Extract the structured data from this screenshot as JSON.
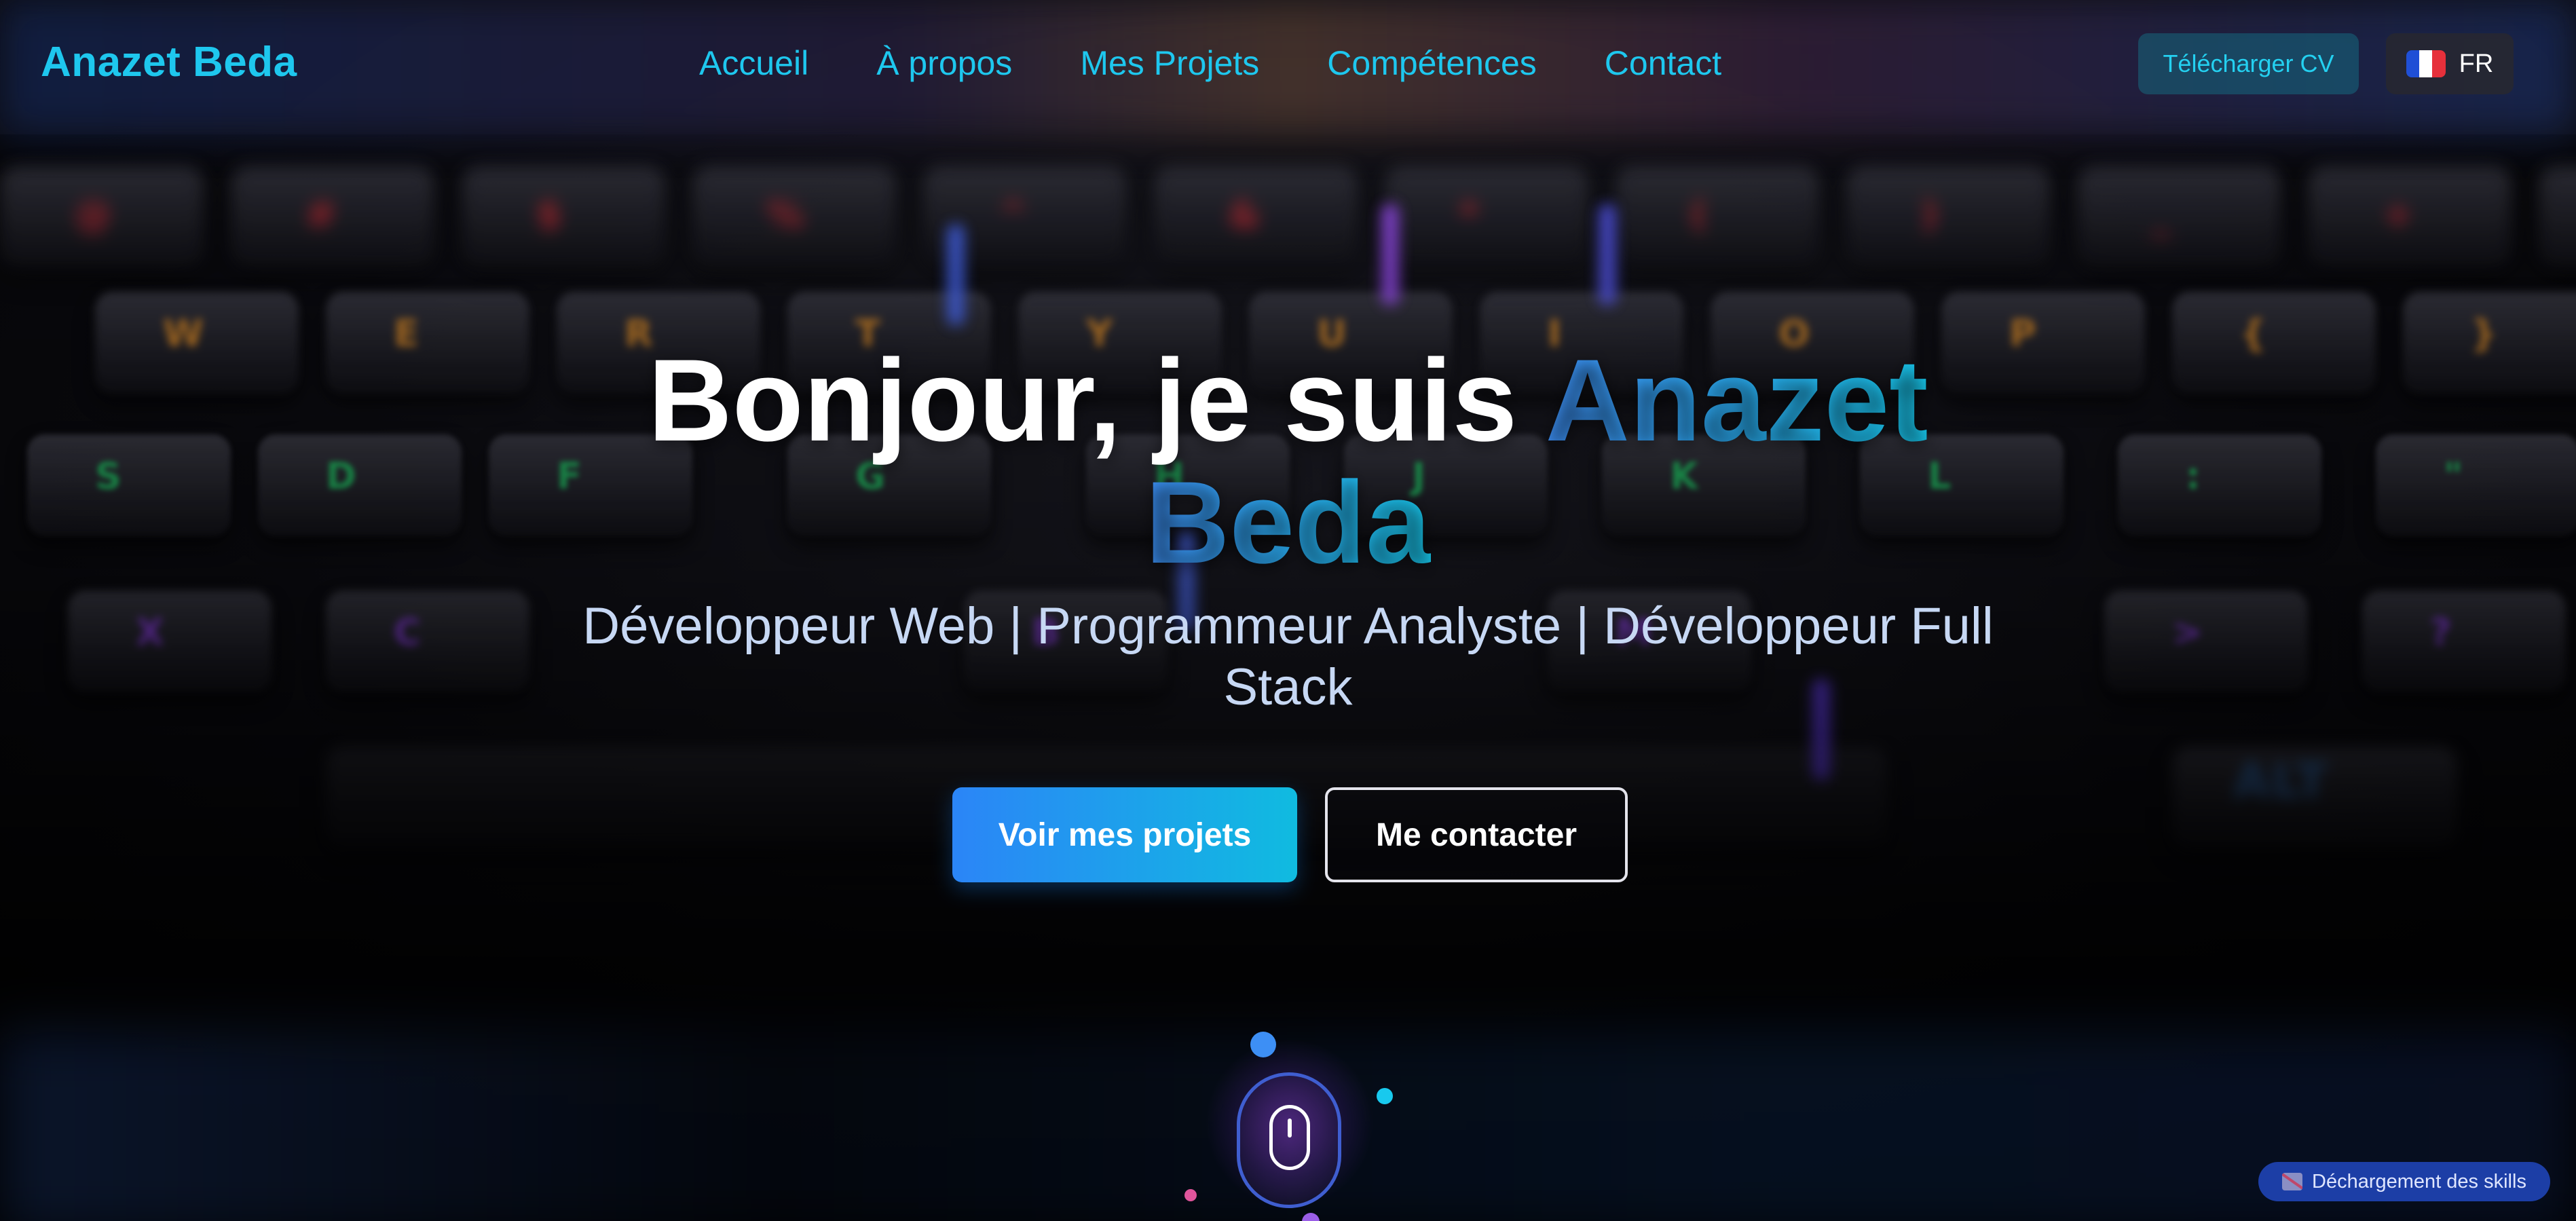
{
  "navbar": {
    "brand": "Anazet Beda",
    "links": [
      "Accueil",
      "À propos",
      "Mes Projets",
      "Compétences",
      "Contact"
    ],
    "cv_button": "Télécharger CV",
    "language": "FR",
    "language_flag_icon": "france-flag-icon"
  },
  "hero": {
    "greeting": "Bonjour, je suis ",
    "name_first": "Anazet",
    "name_last": "Beda",
    "subtitle": "Développeur Web | Programmeur Analyste | Développeur Full Stack",
    "primary_button": "Voir mes projets",
    "secondary_button": "Me contacter"
  },
  "scroll_indicator": {
    "icon": "mouse-icon"
  },
  "toast": {
    "label": "Déchargement des skills",
    "icon": "broken-image-icon"
  },
  "colors": {
    "accent_cyan": "#1ec7ee",
    "accent_blue": "#2b85f7",
    "subtitle_text": "#c7d8f4",
    "toast_bg": "#1c3ea6"
  }
}
